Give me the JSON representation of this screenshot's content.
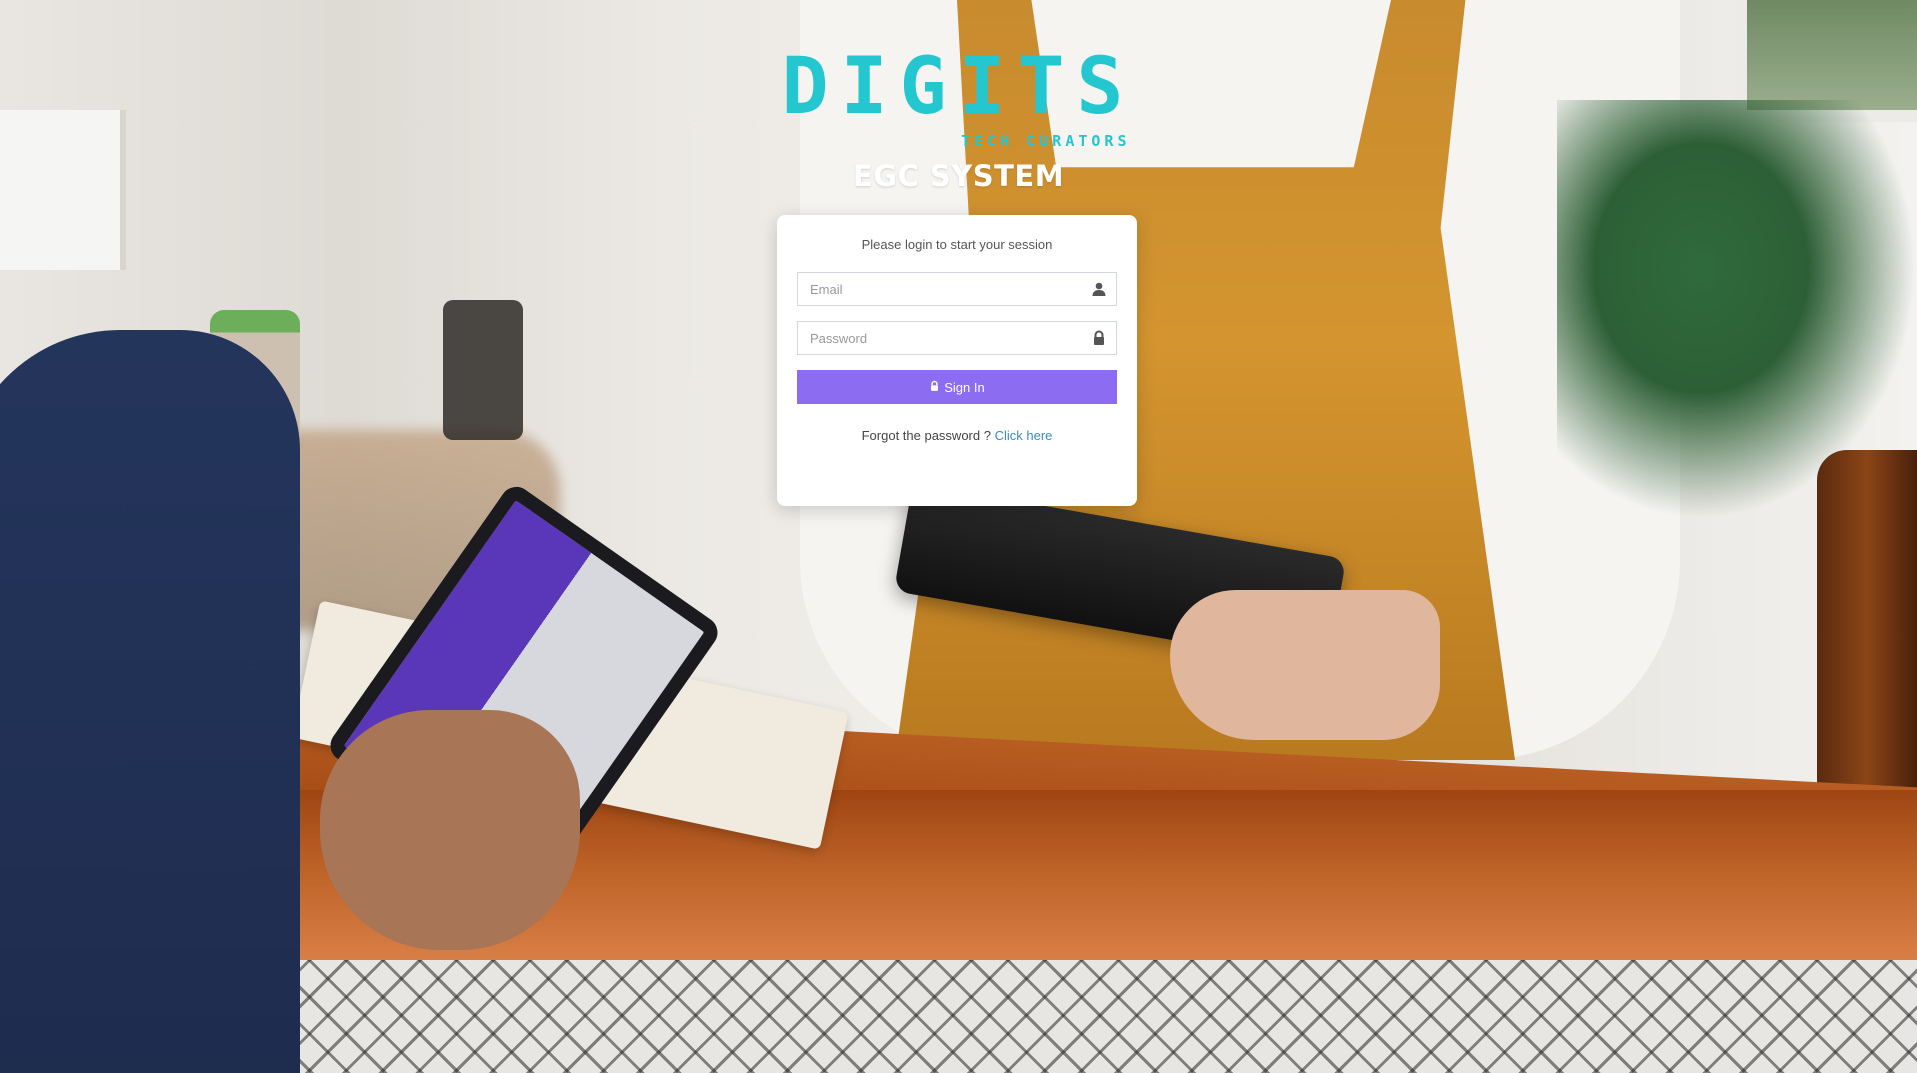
{
  "brand": {
    "logo_text": "DIGITS",
    "logo_tagline": "TECH CURATORS",
    "system_title": "EGC SYSTEM"
  },
  "login": {
    "message": "Please login to start your session",
    "email": {
      "placeholder": "Email",
      "value": "",
      "icon": "user-icon"
    },
    "password": {
      "placeholder": "Password",
      "value": "",
      "icon": "lock-icon"
    },
    "signin_label": "Sign In",
    "signin_icon": "lock-icon",
    "forgot_text": "Forgot the password ?",
    "forgot_link": "Click here"
  },
  "colors": {
    "brand_accent": "#24c6cf",
    "button": "#8c6cf0",
    "link": "#3c8dbc"
  }
}
